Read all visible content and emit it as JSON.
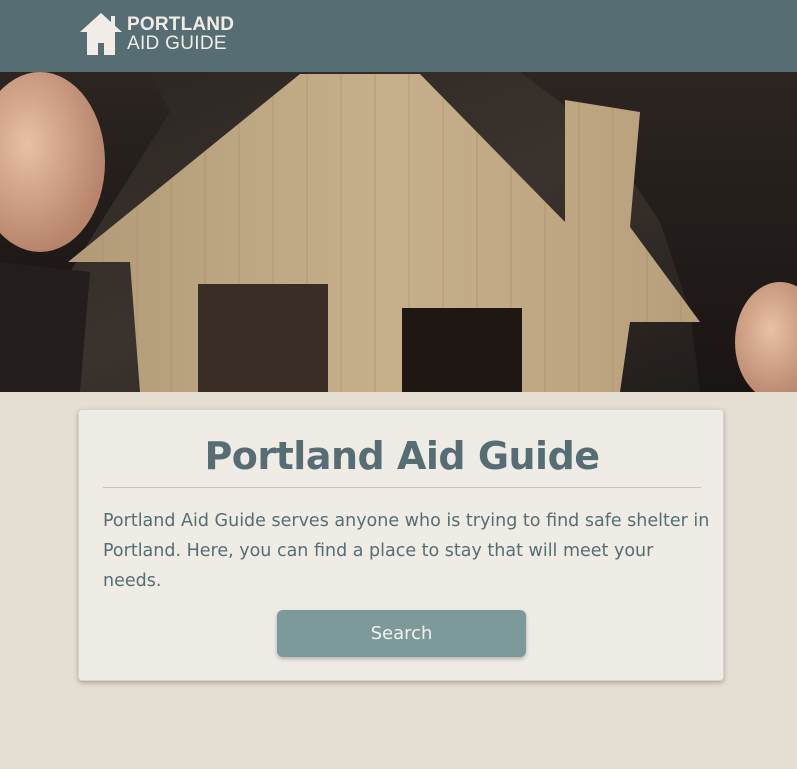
{
  "header": {
    "logo_line1": "PORTLAND",
    "logo_line2": "AID GUIDE",
    "logo_icon": "house-icon",
    "background_color": "#566e73"
  },
  "hero": {
    "image_subject": "cardboard house cutout held in gloved hands"
  },
  "card": {
    "title": "Portland Aid Guide",
    "description": "Portland Aid Guide serves anyone who is trying to find safe shelter in Portland. Here, you can find a place to stay that will meet your needs.",
    "button_label": "Search",
    "button_color": "#7b9a99",
    "text_color": "#566e73"
  },
  "page": {
    "background_color": "#e5ded3"
  }
}
